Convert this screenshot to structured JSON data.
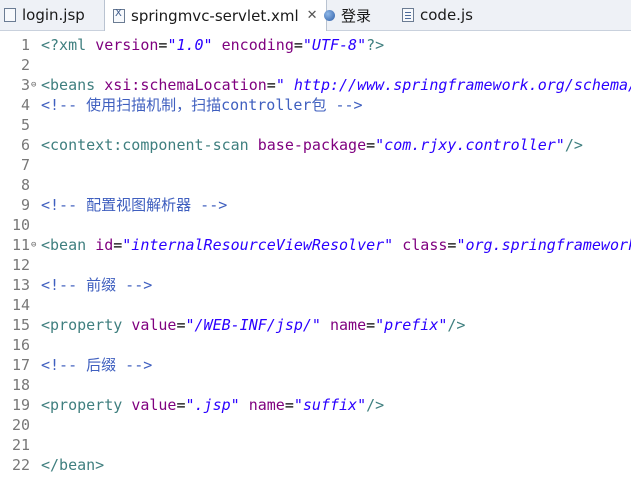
{
  "tabs": [
    {
      "label": "login.jsp",
      "icon": "jsp-file-icon"
    },
    {
      "label": "springmvc-servlet.xml",
      "icon": "xml-file-icon",
      "close": "✕"
    },
    {
      "label": "登录",
      "icon": "globe-icon"
    },
    {
      "label": "code.js",
      "icon": "js-file-icon"
    }
  ],
  "lines": [
    {
      "n": "1",
      "tokens": [
        {
          "t": "<?xml ",
          "c": "tag"
        },
        {
          "t": "version",
          "c": "attr"
        },
        {
          "t": "=",
          "c": "plain"
        },
        {
          "t": "\"1.0\"",
          "c": "val"
        },
        {
          "t": " ",
          "c": "plain"
        },
        {
          "t": "encoding",
          "c": "attr"
        },
        {
          "t": "=",
          "c": "plain"
        },
        {
          "t": "\"UTF-8\"",
          "c": "val"
        },
        {
          "t": "?>",
          "c": "tag"
        }
      ]
    },
    {
      "n": "2",
      "tokens": []
    },
    {
      "n": "3",
      "fold": "⊖",
      "tokens": [
        {
          "t": "<beans ",
          "c": "tag"
        },
        {
          "t": "xsi:schemaLocation",
          "c": "attr"
        },
        {
          "t": "=",
          "c": "plain"
        },
        {
          "t": "\" http://www.springframework.org/schema/",
          "c": "val"
        }
      ]
    },
    {
      "n": "4",
      "tokens": [
        {
          "t": "<!-- 使用扫描机制，扫描controller包 -->",
          "c": "com"
        }
      ]
    },
    {
      "n": "5",
      "tokens": []
    },
    {
      "n": "6",
      "tokens": [
        {
          "t": "<context:component-scan ",
          "c": "tag"
        },
        {
          "t": "base-package",
          "c": "attr"
        },
        {
          "t": "=",
          "c": "plain"
        },
        {
          "t": "\"com.rjxy.controller\"",
          "c": "val"
        },
        {
          "t": "/>",
          "c": "tag"
        }
      ]
    },
    {
      "n": "7",
      "tokens": []
    },
    {
      "n": "8",
      "tokens": []
    },
    {
      "n": "9",
      "tokens": [
        {
          "t": "<!-- 配置视图解析器 -->",
          "c": "com"
        }
      ]
    },
    {
      "n": "10",
      "tokens": []
    },
    {
      "n": "11",
      "fold": "⊖",
      "tokens": [
        {
          "t": "<bean ",
          "c": "tag"
        },
        {
          "t": "id",
          "c": "attr"
        },
        {
          "t": "=",
          "c": "plain"
        },
        {
          "t": "\"internalResourceViewResolver\"",
          "c": "val"
        },
        {
          "t": " ",
          "c": "plain"
        },
        {
          "t": "class",
          "c": "attr"
        },
        {
          "t": "=",
          "c": "plain"
        },
        {
          "t": "\"org.springframework",
          "c": "val"
        }
      ]
    },
    {
      "n": "12",
      "tokens": []
    },
    {
      "n": "13",
      "tokens": [
        {
          "t": "<!-- 前缀 -->",
          "c": "com"
        }
      ]
    },
    {
      "n": "14",
      "tokens": []
    },
    {
      "n": "15",
      "tokens": [
        {
          "t": "<property ",
          "c": "tag"
        },
        {
          "t": "value",
          "c": "attr"
        },
        {
          "t": "=",
          "c": "plain"
        },
        {
          "t": "\"/WEB-INF/jsp/\"",
          "c": "val"
        },
        {
          "t": " ",
          "c": "plain"
        },
        {
          "t": "name",
          "c": "attr"
        },
        {
          "t": "=",
          "c": "plain"
        },
        {
          "t": "\"prefix\"",
          "c": "val"
        },
        {
          "t": "/>",
          "c": "tag"
        }
      ]
    },
    {
      "n": "16",
      "tokens": []
    },
    {
      "n": "17",
      "tokens": [
        {
          "t": "<!-- 后缀 -->",
          "c": "com"
        }
      ]
    },
    {
      "n": "18",
      "tokens": []
    },
    {
      "n": "19",
      "tokens": [
        {
          "t": "<property ",
          "c": "tag"
        },
        {
          "t": "value",
          "c": "attr"
        },
        {
          "t": "=",
          "c": "plain"
        },
        {
          "t": "\".jsp\"",
          "c": "val"
        },
        {
          "t": " ",
          "c": "plain"
        },
        {
          "t": "name",
          "c": "attr"
        },
        {
          "t": "=",
          "c": "plain"
        },
        {
          "t": "\"suffix\"",
          "c": "val"
        },
        {
          "t": "/>",
          "c": "tag"
        }
      ]
    },
    {
      "n": "20",
      "tokens": []
    },
    {
      "n": "21",
      "tokens": []
    },
    {
      "n": "22",
      "tokens": [
        {
          "t": "</bean>",
          "c": "tag"
        }
      ]
    }
  ]
}
